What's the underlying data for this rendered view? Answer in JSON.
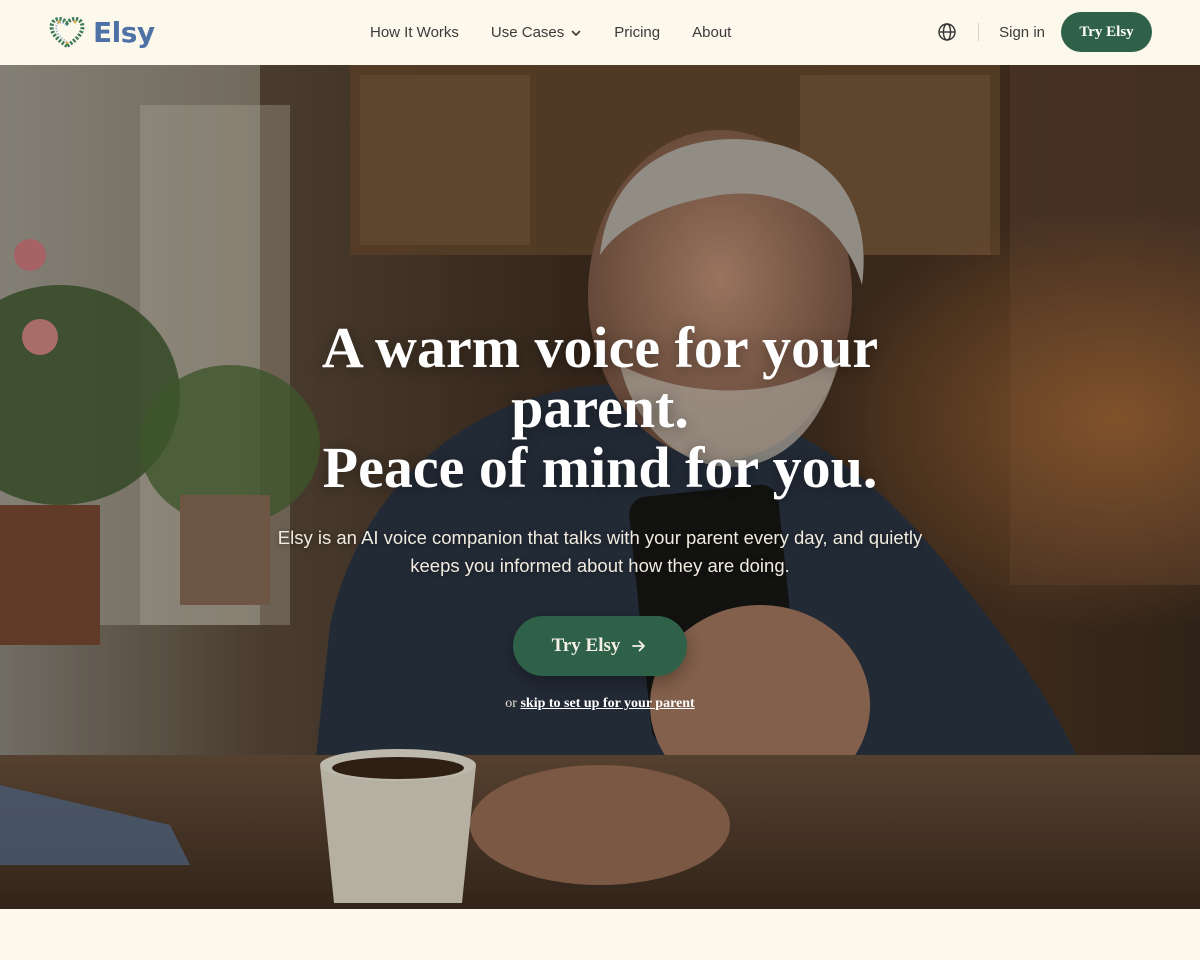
{
  "brand": {
    "name": "Elsy",
    "logo_icon": "heart-wreath-icon",
    "color": "#4e72a6"
  },
  "nav": {
    "links": [
      {
        "label": "How It Works"
      },
      {
        "label": "Use Cases",
        "has_dropdown": true
      },
      {
        "label": "Pricing"
      },
      {
        "label": "About"
      }
    ],
    "language_icon": "globe-icon",
    "sign_in": "Sign in",
    "cta": "Try Elsy"
  },
  "hero": {
    "title_line1": "A warm voice for your parent.",
    "title_line2": "Peace of mind for you.",
    "subtitle": "Elsy is an AI voice companion that talks with your parent every day, and quietly keeps you informed about how they are doing.",
    "cta": "Try Elsy",
    "cta_icon": "arrow-right-icon",
    "skip_prefix": "or",
    "skip_link": "skip to set up for your parent"
  },
  "colors": {
    "accent": "#2f6148",
    "background": "#fdf8ec"
  }
}
